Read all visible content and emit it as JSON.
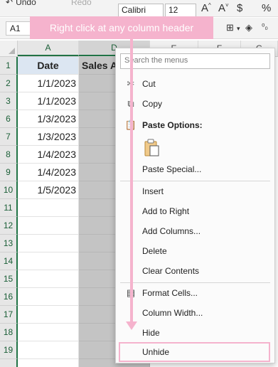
{
  "ribbon": {
    "undo_label": "Undo",
    "redo_label": "Redo",
    "font_name": "Calibri",
    "font_size": "12",
    "increase_font_glyph": "A^",
    "decrease_font_glyph": "A˅",
    "currency_glyph": "$",
    "percent_glyph": "%"
  },
  "formula_bar": {
    "name_box": "A1"
  },
  "tooltip": {
    "text": "Right click at any column header"
  },
  "columns": [
    {
      "label": "A",
      "state": "selected-light"
    },
    {
      "label": "D",
      "state": "selected"
    },
    {
      "label": "E",
      "state": "normal"
    },
    {
      "label": "F",
      "state": "normal"
    },
    {
      "label": "G",
      "state": "normal"
    }
  ],
  "rows": [
    {
      "num": "1",
      "date": "Date",
      "sales": "Sales A"
    },
    {
      "num": "2",
      "date": "1/1/2023",
      "sales": ""
    },
    {
      "num": "3",
      "date": "1/1/2023",
      "sales": ""
    },
    {
      "num": "6",
      "date": "1/3/2023",
      "sales": ""
    },
    {
      "num": "7",
      "date": "1/3/2023",
      "sales": ""
    },
    {
      "num": "8",
      "date": "1/4/2023",
      "sales": ""
    },
    {
      "num": "9",
      "date": "1/4/2023",
      "sales": ""
    },
    {
      "num": "10",
      "date": "1/5/2023",
      "sales": ""
    },
    {
      "num": "11",
      "date": "",
      "sales": ""
    },
    {
      "num": "12",
      "date": "",
      "sales": ""
    },
    {
      "num": "13",
      "date": "",
      "sales": ""
    },
    {
      "num": "14",
      "date": "",
      "sales": ""
    },
    {
      "num": "15",
      "date": "",
      "sales": ""
    },
    {
      "num": "16",
      "date": "",
      "sales": ""
    },
    {
      "num": "17",
      "date": "",
      "sales": ""
    },
    {
      "num": "18",
      "date": "",
      "sales": ""
    },
    {
      "num": "19",
      "date": "",
      "sales": ""
    }
  ],
  "context_menu": {
    "search_placeholder": "Search the menus",
    "items": {
      "cut": "Cut",
      "copy": "Copy",
      "paste_options": "Paste Options:",
      "paste_special": "Paste Special...",
      "insert": "Insert",
      "add_to_right": "Add to Right",
      "add_columns": "Add Columns...",
      "delete": "Delete",
      "clear_contents": "Clear Contents",
      "format_cells": "Format Cells...",
      "column_width": "Column Width...",
      "hide": "Hide",
      "unhide": "Unhide"
    }
  },
  "colors": {
    "accent_pink": "#f5b3cd",
    "excel_green": "#217346",
    "header_fill": "#dce6f2"
  }
}
